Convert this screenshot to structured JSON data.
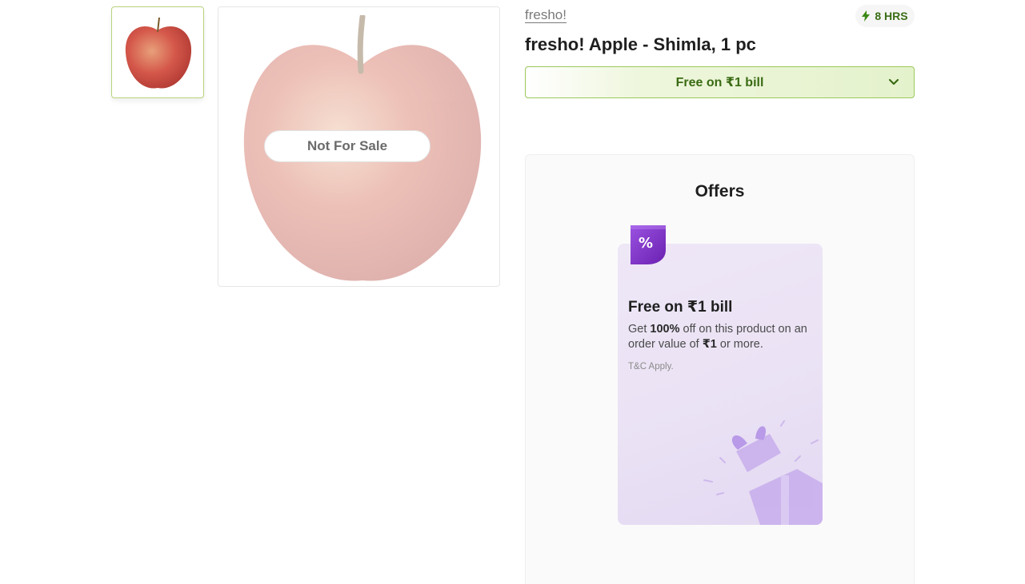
{
  "gallery": {
    "not_for_sale_label": "Not For Sale"
  },
  "product": {
    "brand": "fresho!",
    "title": "fresho! Apple - Shimla, 1 pc",
    "delivery_time": "8 HRS",
    "offer_strip_label": "Free on ₹1 bill"
  },
  "offers": {
    "section_title": "Offers",
    "card": {
      "tag_symbol": "%",
      "heading": "Free on ₹1 bill",
      "desc_get": "Get ",
      "desc_percent": "100%",
      "desc_mid": " off on this product on an order value of ",
      "desc_amount": "₹1",
      "desc_end": " or more.",
      "terms": "T&C Apply."
    }
  },
  "colors": {
    "accent_green": "#3a6b14",
    "border_green": "#9cc95a",
    "offer_purple": "#7a2fc0"
  },
  "icons": [
    "apple-thumbnail",
    "apple-image",
    "lightning-icon",
    "chevron-down-icon",
    "percent-tag-icon",
    "gift-icon"
  ]
}
